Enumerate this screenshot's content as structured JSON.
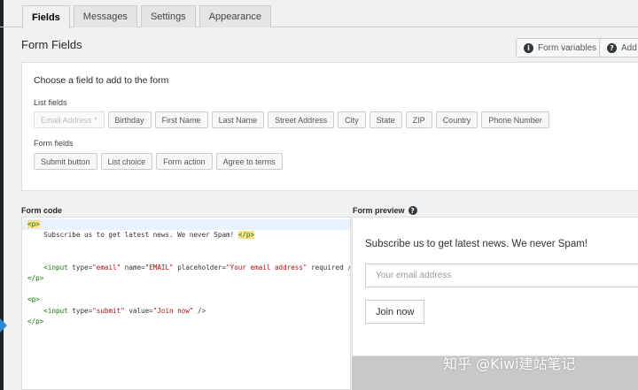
{
  "tabs": [
    {
      "label": "Fields",
      "active": true
    },
    {
      "label": "Messages",
      "active": false
    },
    {
      "label": "Settings",
      "active": false
    },
    {
      "label": "Appearance",
      "active": false
    }
  ],
  "page_title": "Form Fields",
  "toolbar": {
    "form_variables_label": "Form variables",
    "add_label": "Add"
  },
  "field_panel": {
    "heading": "Choose a field to add to the form",
    "list_fields_label": "List fields",
    "list_fields": [
      "Email Address *",
      "Birthday",
      "First Name",
      "Last Name",
      "Street Address",
      "City",
      "State",
      "ZIP",
      "Country",
      "Phone Number"
    ],
    "form_fields_label": "Form fields",
    "form_fields": [
      "Submit button",
      "List choice",
      "Form action",
      "Agree to terms"
    ]
  },
  "form_code": {
    "label": "Form code",
    "lines": [
      "<p>",
      "    Subscribe us to get latest news. We never Spam! </p>",
      "",
      "",
      "    <input type=\"email\" name=\"EMAIL\" placeholder=\"Your email address\" required />",
      "</p>",
      "",
      "<p>",
      "    <input type=\"submit\" value=\"Join now\" />",
      "</p>"
    ]
  },
  "form_preview": {
    "label": "Form preview",
    "text": "Subscribe us to get latest news. We never Spam!",
    "email_placeholder": "Your email address",
    "submit_label": "Join now"
  },
  "watermark": "知乎 @Kiwi建站笔记",
  "colors": {
    "accent": "#2b8bd6",
    "code_tag": "#117700",
    "code_string": "#aa1111",
    "highlight_line": "#e8f2fe"
  },
  "icons": [
    "info-icon",
    "help-icon",
    "collapse-arrow-icon"
  ]
}
